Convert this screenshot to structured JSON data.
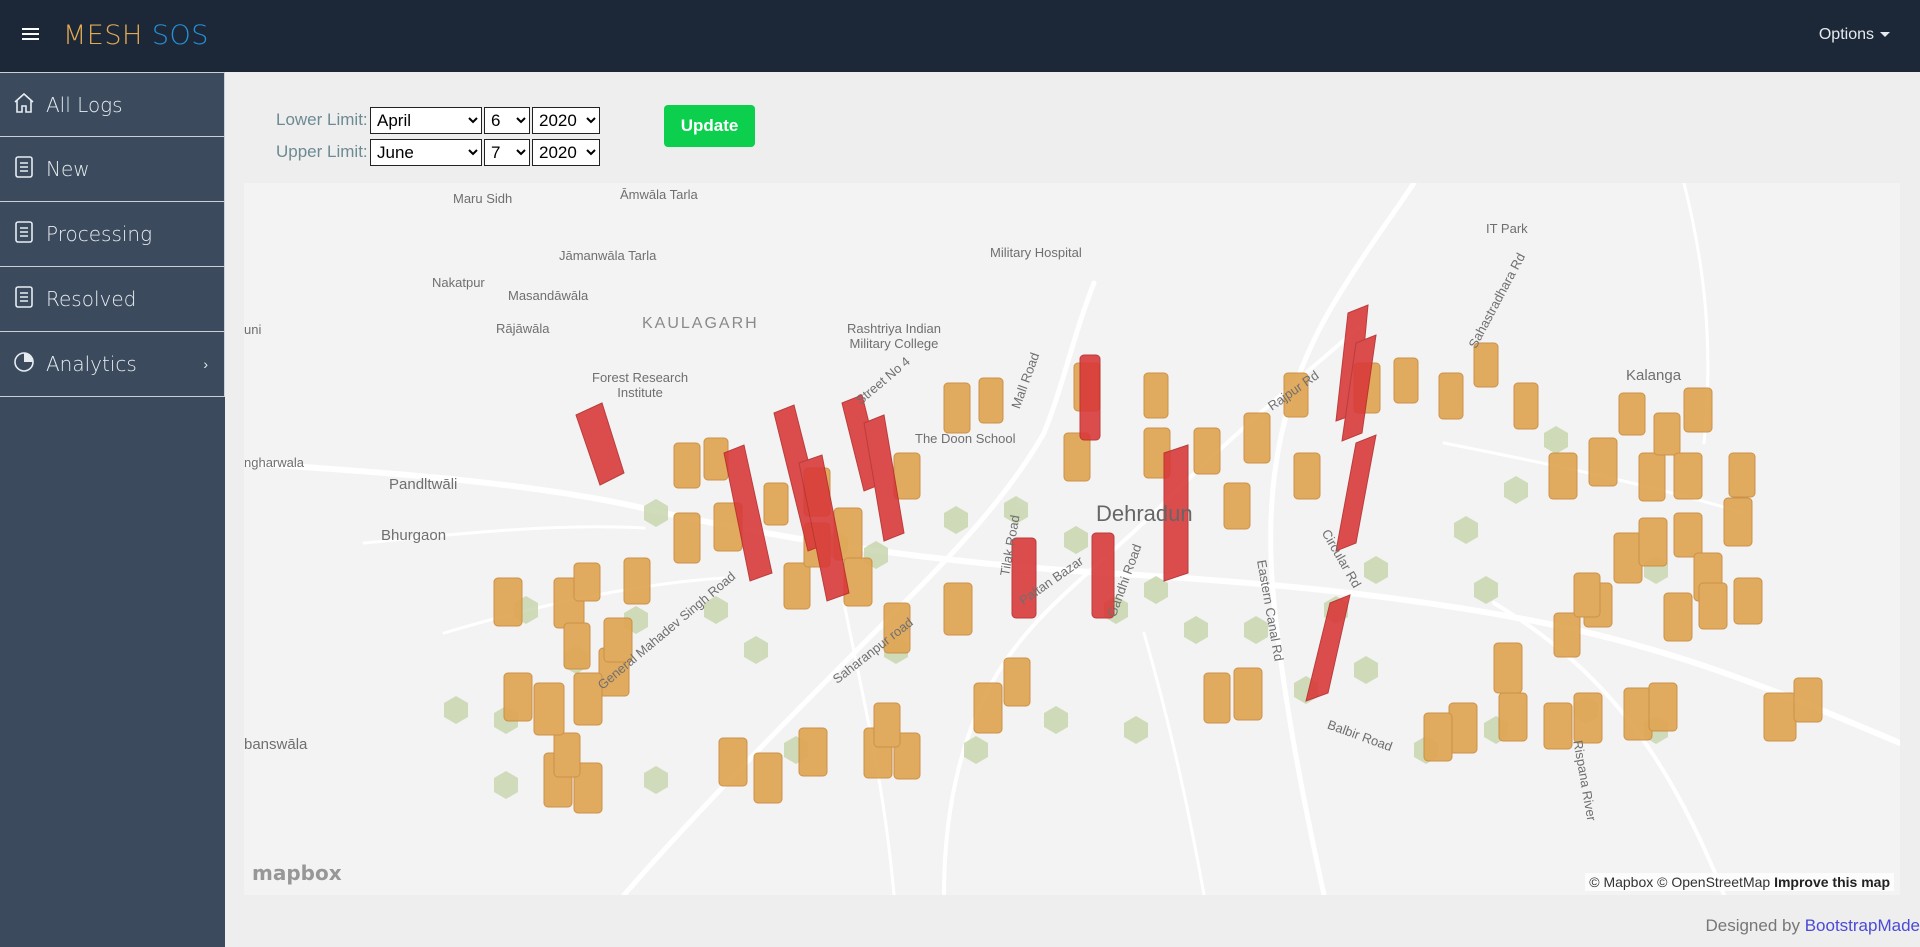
{
  "header": {
    "brand_part1": "MESH",
    "brand_part2": "SOS",
    "options_label": "Options"
  },
  "sidebar": {
    "items": [
      {
        "label": "All Logs",
        "icon": "home-icon"
      },
      {
        "label": "New",
        "icon": "document-icon"
      },
      {
        "label": "Processing",
        "icon": "document-icon"
      },
      {
        "label": "Resolved",
        "icon": "document-icon"
      },
      {
        "label": "Analytics",
        "icon": "pie-chart-icon"
      }
    ]
  },
  "filters": {
    "lower_label": "Lower Limit:",
    "upper_label": "Upper Limit:",
    "lower": {
      "month": "April",
      "day": "6",
      "year": "2020"
    },
    "upper": {
      "month": "June",
      "day": "7",
      "year": "2020"
    },
    "update_label": "Update"
  },
  "map": {
    "places": {
      "maru_sidh": "Maru Sidh",
      "amwala_tarla": "Āmwāla Tarla",
      "it_park": "IT Park",
      "jamanwala_tarla": "Jāmanwāla Tarla",
      "military_hospital": "Military Hospital",
      "nakatpur": "Nakatpur",
      "masandawala": "Masandāwāla",
      "sahastradhara_rd": "Sahastradhara Rd",
      "uni": "uni",
      "rajawala": "Rājāwāla",
      "kaulagarh": "KAULAGARH",
      "rimc_1": "Rashtriya Indian",
      "rimc_2": "Military College",
      "kalanga": "Kalanga",
      "forest_1": "Forest Research",
      "forest_2": "Institute",
      "street_no4": "Street No 4",
      "mall_road": "Mall Road",
      "rajpur_rd": "Rajpur Rd",
      "doon_school": "The Doon School",
      "ngharwala": "ngharwala",
      "pandltwali": "Pandltwāli",
      "dehradun": "Dehradun",
      "bhurgaon": "Bhurgaon",
      "tilak_road": "Tilak Road",
      "circular_rd": "Circular Rd",
      "gen_mahadev": "General Mahadev Singh Road",
      "paltan_bazar": "Paltan Bazar",
      "gandhi_road": "Gandhi Road",
      "eastern_canal": "Eastern Canal Rd",
      "saharanpur": "Saharanpur road",
      "banswala": "banswāla",
      "balbir_road": "Balbir Road",
      "rispana": "Rispana River"
    },
    "mapbox_logo": "mapbox",
    "attribution": "© Mapbox © OpenStreetMap",
    "improve": "Improve this map"
  },
  "footer": {
    "text": "Designed by ",
    "link": "BootstrapMade"
  }
}
